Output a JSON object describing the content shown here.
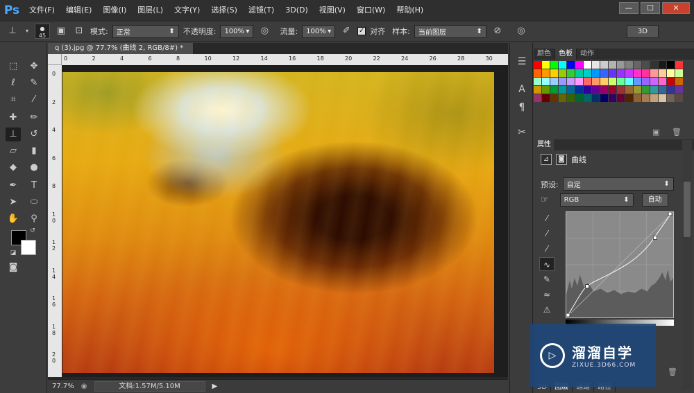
{
  "app": {
    "logo": "Ps"
  },
  "menu": [
    "文件(F)",
    "编辑(E)",
    "图像(I)",
    "图层(L)",
    "文字(Y)",
    "选择(S)",
    "滤镜(T)",
    "3D(D)",
    "视图(V)",
    "窗口(W)",
    "帮助(H)"
  ],
  "window_buttons": {
    "minimize": "—",
    "maximize": "☐",
    "close": "✕"
  },
  "options": {
    "brush_size": "45",
    "mode_label": "模式:",
    "mode_value": "正常",
    "opacity_label": "不透明度:",
    "opacity_value": "100%",
    "flow_label": "流量:",
    "flow_value": "100%",
    "align_label": "对齐",
    "sample_label": "样本:",
    "sample_value": "当前图层",
    "workspace": "3D"
  },
  "document": {
    "tab_title": "q (3).jpg @ 77.7% (曲线 2, RGB/8#) *",
    "close_tab": "×",
    "ruler_h": [
      "0",
      "2",
      "4",
      "6",
      "8",
      "10",
      "12",
      "14",
      "16",
      "18",
      "20",
      "22",
      "24",
      "26",
      "28",
      "30"
    ],
    "ruler_v": [
      "0",
      "2",
      "4",
      "6",
      "8",
      "1\n0",
      "1\n2",
      "1\n4",
      "1\n6",
      "1\n8",
      "2\n0"
    ]
  },
  "status": {
    "zoom": "77.7%",
    "doc_info": "文档:1.57M/5.10M"
  },
  "panels": {
    "swatch_tabs": [
      "颜色",
      "色板",
      "动作"
    ],
    "swatch_active": "色板",
    "props_tab": "属性",
    "curves_title": "曲线",
    "preset_label": "预设:",
    "preset_value": "自定",
    "channel_value": "RGB",
    "auto_button": "自动",
    "bottom_tabs": [
      "3D",
      "图层",
      "通道",
      "路径"
    ]
  },
  "swatch_colors": [
    "#ff0000",
    "#ffff00",
    "#00ff00",
    "#00ffff",
    "#0000ff",
    "#ff00ff",
    "#ffffff",
    "#e6e6e6",
    "#cccccc",
    "#b3b3b3",
    "#999999",
    "#808080",
    "#666666",
    "#4d4d4d",
    "#333333",
    "#1a1a1a",
    "#000000",
    "#ff3333",
    "#ff6600",
    "#ff9900",
    "#ffcc00",
    "#99cc00",
    "#33cc33",
    "#00cc99",
    "#00cccc",
    "#0099ff",
    "#3366ff",
    "#6633ff",
    "#9933ff",
    "#cc33ff",
    "#ff33cc",
    "#ff3399",
    "#ff9999",
    "#ffcc99",
    "#ffff99",
    "#ccff99",
    "#99ffcc",
    "#99ffff",
    "#99ccff",
    "#9999ff",
    "#cc99ff",
    "#ff99ff",
    "#ff6666",
    "#ff9966",
    "#ffcc66",
    "#ccff66",
    "#66ff99",
    "#66ffff",
    "#6699ff",
    "#9966ff",
    "#cc66ff",
    "#ff66cc",
    "#cc0000",
    "#cc6600",
    "#cc9900",
    "#669900",
    "#009933",
    "#009999",
    "#006699",
    "#003399",
    "#330099",
    "#660099",
    "#990066",
    "#990033",
    "#993333",
    "#996633",
    "#999933",
    "#339933",
    "#339999",
    "#336699",
    "#333399",
    "#663399",
    "#993366",
    "#660000",
    "#663300",
    "#666600",
    "#336600",
    "#006633",
    "#006666",
    "#003366",
    "#000066",
    "#330066",
    "#660033",
    "#4d2600",
    "#8c6239",
    "#a67c52",
    "#c7a17a",
    "#d9c3a5",
    "#736357",
    "#594a42"
  ],
  "icons": {
    "curves_adjust": "curves-adjust-icon",
    "mask": "mask-icon"
  },
  "watermark": {
    "brand_cn": "溜溜自学",
    "brand_en": "ZIXUE.3D66.COM",
    "logo_glyph": "▷"
  }
}
